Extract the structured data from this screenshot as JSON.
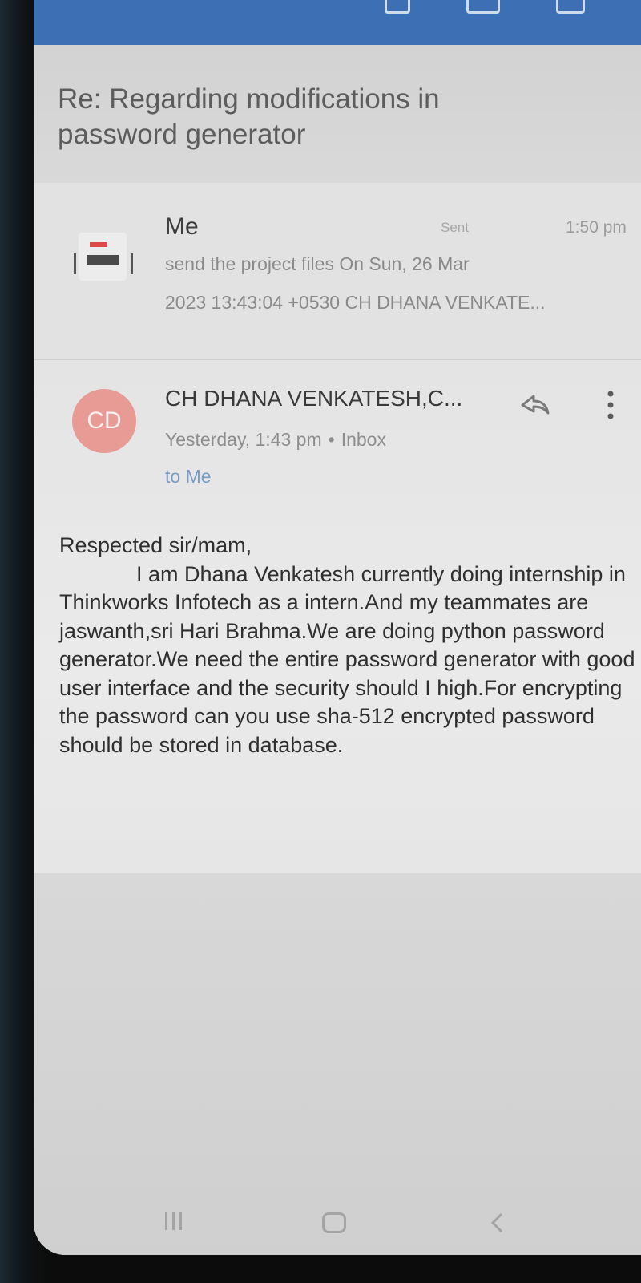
{
  "email": {
    "subject": "Re: Regarding modifications in password generator"
  },
  "collapsed_message": {
    "sender": "Me",
    "status": "Sent",
    "time": "1:50 pm",
    "preview_line_1": "send the project files  On Sun, 26 Mar",
    "preview_line_2": "2023 13:43:04 +0530 CH DHANA VENKATE..."
  },
  "open_message": {
    "avatar_initials": "CD",
    "avatar_color": "#e89a94",
    "sender": "CH DHANA VENKATESH,C...",
    "date": "Yesterday, 1:43 pm",
    "separator": "•",
    "folder": "Inbox",
    "recipient": "to Me",
    "greeting": "Respected sir/mam,",
    "body": "I am Dhana Venkatesh currently doing internship in Thinkworks Infotech as a intern.And my teammates are jaswanth,sri Hari Brahma.We are doing python password generator.We need the entire password generator with good user interface and the security should I high.For encrypting the password can you use sha-512  encrypted password should be stored in database."
  },
  "icons": {
    "reply": "reply-icon",
    "more": "more-vert-icon",
    "attachment_thumb": "document-icon"
  },
  "colors": {
    "top_bar": "#3c6fb4",
    "recipient_link": "#7a9cc2"
  }
}
